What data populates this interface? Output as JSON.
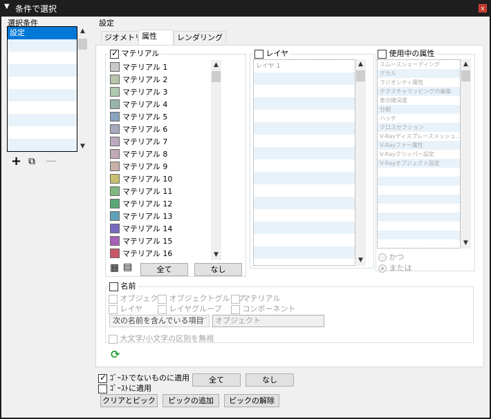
{
  "title": "条件で選択",
  "close_label": "x",
  "left": {
    "header": "選択条件",
    "items": [
      "設定",
      "",
      "",
      "",
      "",
      "",
      "",
      "",
      "",
      ""
    ]
  },
  "settings_label": "設定",
  "tabs": [
    "ジオメトリ",
    "属性",
    "レンダリング"
  ],
  "materials": {
    "header": "マテリアル",
    "checked": true,
    "items": [
      {
        "label": "マテリアル 1",
        "color": "#c9c9c9"
      },
      {
        "label": "マテリアル 2",
        "color": "#b8c4a8"
      },
      {
        "label": "マテリアル 3",
        "color": "#b0c7b0"
      },
      {
        "label": "マテリアル 4",
        "color": "#98b4a8"
      },
      {
        "label": "マテリアル 5",
        "color": "#8aa4c0"
      },
      {
        "label": "マテリアル 6",
        "color": "#a8a8bc"
      },
      {
        "label": "マテリアル 7",
        "color": "#bca8bc"
      },
      {
        "label": "マテリアル 8",
        "color": "#c0a8b4"
      },
      {
        "label": "マテリアル 9",
        "color": "#c8b0a8"
      },
      {
        "label": "マテリアル 10",
        "color": "#c8c070"
      },
      {
        "label": "マテリアル 11",
        "color": "#80b880"
      },
      {
        "label": "マテリアル 12",
        "color": "#5aa878"
      },
      {
        "label": "マテリアル 13",
        "color": "#60a0b8"
      },
      {
        "label": "マテリアル 14",
        "color": "#7868c0"
      },
      {
        "label": "マテリアル 15",
        "color": "#a860b8"
      },
      {
        "label": "マテリアル 16",
        "color": "#c85868"
      }
    ],
    "all_label": "全て",
    "none_label": "なし"
  },
  "layers": {
    "header": "レイヤ",
    "items": [
      "レイヤ 1"
    ]
  },
  "attrs": {
    "header": "使用中の属性",
    "items": [
      "スムースシェーディング",
      "デカル",
      "ラジオシティ属性",
      "テクスチャマッピングの編集",
      "表示線深度",
      "分割",
      "ハッチ",
      "クロスセクション",
      "V-Rayディスプレースメッシュ...",
      "V-Rayファー属性",
      "V-Rayクリッパー設定",
      "V-Rayオブジェクト設定"
    ],
    "and_label": "かつ",
    "or_label": "または"
  },
  "name": {
    "header": "名前",
    "object": "オブジェクト",
    "object_group": "オブジェクトグループ",
    "material": "マテリアル",
    "layer": "レイヤ",
    "layer_group": "レイヤグループ",
    "component": "コンポーネント",
    "match_select": "次の名前を含んでいる項目",
    "name_value": "オブジェクト",
    "ignore_case": "大文字/小文字の区別を無視"
  },
  "bottom": {
    "non_ghost": "ｺﾞｰｽﾄでないものに適用",
    "ghost": "ｺﾞｰｽﾄに適用",
    "all_label": "全て",
    "none_label": "なし",
    "clear_pick": "クリアとピック",
    "add_pick": "ピックの追加",
    "remove_pick": "ピックの解除"
  }
}
